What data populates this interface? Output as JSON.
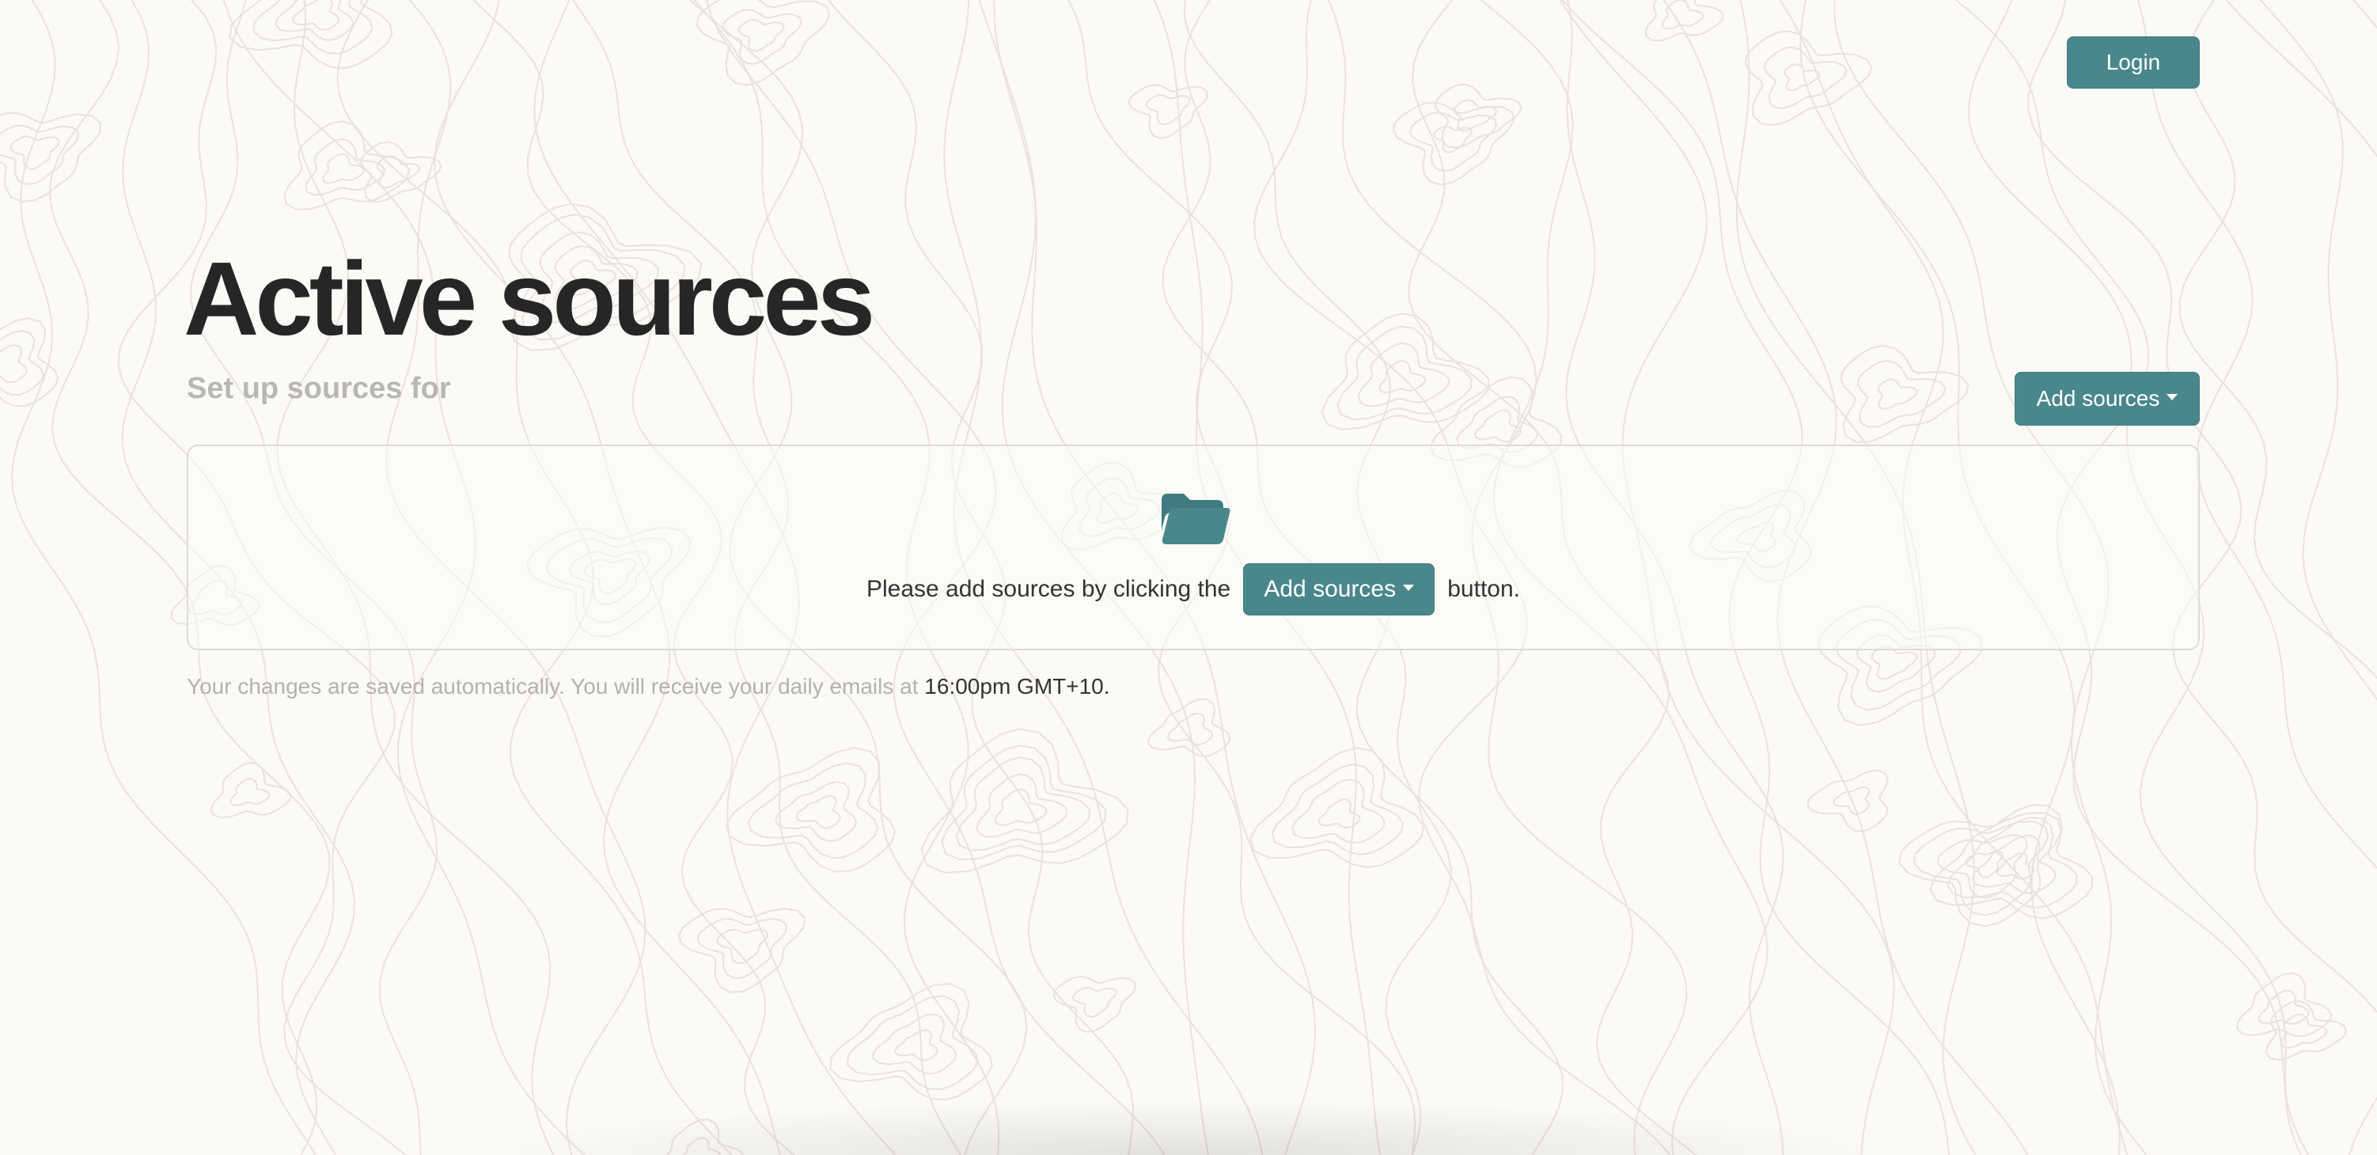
{
  "header": {
    "login_label": "Login"
  },
  "page": {
    "title": "Active sources",
    "subtitle": "Set up sources for",
    "add_sources_label": "Add sources"
  },
  "empty_state": {
    "icon": "folder-icon",
    "text_before": "Please add sources by clicking the",
    "button_label": "Add sources",
    "text_after": "button."
  },
  "footer": {
    "note_prefix": "Your changes are saved automatically. You will receive your daily emails at",
    "time": "16:00pm GMT+10",
    "note_suffix": "."
  },
  "colors": {
    "accent": "#4a878c",
    "background": "#fcfaf7",
    "muted_text": "#b4b2af",
    "title_text": "#262626"
  }
}
